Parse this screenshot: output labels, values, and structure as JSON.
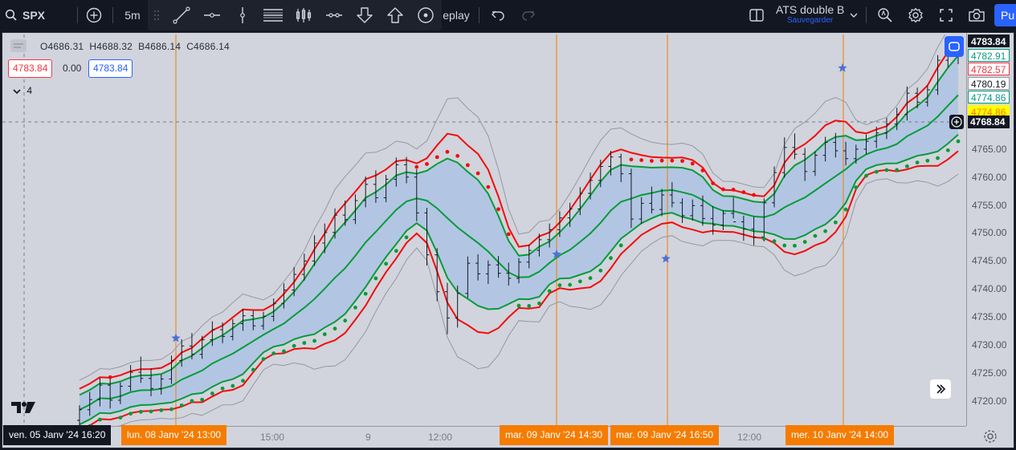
{
  "toolbar": {
    "symbol": "SPX",
    "interval": "5m",
    "replay_label": "eplay",
    "layout_name": "ATS double B",
    "layout_status": "Sauvegarder",
    "publish_label": "Pu"
  },
  "legend": {
    "open": "O4686.31",
    "high": "H4688.32",
    "low": "B4686.14",
    "close": "C4686.14",
    "bid": "4783.84",
    "spread": "0.00",
    "ask": "4783.84",
    "indicators_count": "4"
  },
  "price_axis": {
    "ticks": [
      "4765.00",
      "4760.00",
      "4755.00",
      "4750.00",
      "4745.00",
      "4740.00",
      "4735.00",
      "4730.00",
      "4725.00",
      "4720.00"
    ],
    "labels": [
      {
        "text": "4783.84",
        "bg": "#131722",
        "fg": "#ffffff"
      },
      {
        "text": "4782.91",
        "bg": "#ffffff",
        "fg": "#089981",
        "border": "#089981"
      },
      {
        "text": "4782.57",
        "bg": "#ffffff",
        "fg": "#f23645",
        "border": "#f23645"
      },
      {
        "text": "4780.19",
        "bg": "#ffffff",
        "fg": "#131722",
        "border": "#9598a1"
      },
      {
        "text": "4774.86",
        "bg": "#ffffff",
        "fg": "#089981",
        "border": "#089981"
      },
      {
        "text": "4774.86",
        "bg": "#ffff00",
        "fg": "#f57c00",
        "border": "#ffff00"
      }
    ],
    "crosshair_price": "4768.84"
  },
  "time_axis": {
    "ticks": [
      "15:00",
      "9",
      "12:00",
      "12:00"
    ],
    "markers": [
      {
        "text": "ven. 05 Janv '24   16:20",
        "style": "dark"
      },
      {
        "text": "lun. 08 Janv '24   13:00",
        "style": "orange"
      },
      {
        "text": "mar. 09 Janv '24   14:30",
        "style": "orange"
      },
      {
        "text": "mar. 09 Janv '24   16:50",
        "style": "orange"
      },
      {
        "text": "mer. 10 Janv '24   14:00",
        "style": "orange"
      }
    ]
  },
  "chart_data": {
    "type": "candlestick",
    "symbol": "SPX",
    "interval": "5m",
    "ylim": [
      4715.5,
      4785.5
    ],
    "ohlc": [
      [
        4716.5,
        4719.2,
        4714.8,
        4718.4
      ],
      [
        4718.4,
        4721.6,
        4717.3,
        4720.2
      ],
      [
        4720.2,
        4724.1,
        4719.0,
        4722.8
      ],
      [
        4722.8,
        4724.0,
        4718.6,
        4720.1
      ],
      [
        4720.1,
        4723.3,
        4719.4,
        4722.6
      ],
      [
        4722.6,
        4726.4,
        4721.7,
        4725.1
      ],
      [
        4725.1,
        4727.9,
        4723.2,
        4724.0
      ],
      [
        4724.0,
        4725.8,
        4720.8,
        4722.2
      ],
      [
        4722.2,
        4724.7,
        4721.1,
        4723.9
      ],
      [
        4723.9,
        4728.1,
        4723.0,
        4727.2
      ],
      [
        4727.2,
        4731.0,
        4726.1,
        4729.8
      ],
      [
        4729.8,
        4732.1,
        4727.4,
        4728.3
      ],
      [
        4728.3,
        4731.6,
        4727.5,
        4730.9
      ],
      [
        4730.9,
        4734.2,
        4729.8,
        4732.7
      ],
      [
        4732.7,
        4734.0,
        4730.3,
        4731.5
      ],
      [
        4731.5,
        4734.6,
        4730.8,
        4733.8
      ],
      [
        4733.8,
        4736.4,
        4732.5,
        4735.2
      ],
      [
        4735.2,
        4736.1,
        4732.6,
        4733.4
      ],
      [
        4733.4,
        4735.9,
        4732.7,
        4735.1
      ],
      [
        4735.1,
        4738.3,
        4734.2,
        4737.4
      ],
      [
        4737.4,
        4741.0,
        4736.5,
        4739.8
      ],
      [
        4739.8,
        4743.9,
        4738.7,
        4742.6
      ],
      [
        4742.6,
        4746.3,
        4741.5,
        4745.0
      ],
      [
        4745.0,
        4749.6,
        4744.1,
        4748.2
      ],
      [
        4748.2,
        4751.7,
        4746.4,
        4750.1
      ],
      [
        4750.1,
        4754.4,
        4749.0,
        4753.2
      ],
      [
        4753.2,
        4755.8,
        4751.3,
        4752.4
      ],
      [
        4752.4,
        4756.9,
        4751.6,
        4755.8
      ],
      [
        4755.8,
        4760.1,
        4754.6,
        4758.7
      ],
      [
        4758.7,
        4761.2,
        4755.4,
        4756.3
      ],
      [
        4756.3,
        4760.4,
        4755.5,
        4759.6
      ],
      [
        4759.6,
        4763.5,
        4758.3,
        4762.2
      ],
      [
        4762.2,
        4763.6,
        4758.9,
        4760.0
      ],
      [
        4760.0,
        4761.4,
        4752.1,
        4753.6
      ],
      [
        4753.6,
        4754.5,
        4744.2,
        4746.1
      ],
      [
        4746.1,
        4747.3,
        4737.8,
        4739.5
      ],
      [
        4739.5,
        4741.1,
        4731.9,
        4734.8
      ],
      [
        4734.8,
        4740.6,
        4733.1,
        4739.2
      ],
      [
        4739.2,
        4745.8,
        4738.4,
        4744.6
      ],
      [
        4744.6,
        4746.2,
        4741.5,
        4742.7
      ],
      [
        4742.7,
        4745.1,
        4740.9,
        4744.3
      ],
      [
        4744.3,
        4745.9,
        4742.0,
        4742.8
      ],
      [
        4742.8,
        4744.7,
        4740.6,
        4741.9
      ],
      [
        4741.9,
        4745.5,
        4741.0,
        4744.8
      ],
      [
        4744.8,
        4747.9,
        4743.7,
        4746.9
      ],
      [
        4746.9,
        4749.9,
        4745.8,
        4748.8
      ],
      [
        4748.8,
        4751.7,
        4747.4,
        4750.6
      ],
      [
        4750.6,
        4753.9,
        4749.3,
        4752.7
      ],
      [
        4752.7,
        4755.4,
        4751.1,
        4754.3
      ],
      [
        4754.3,
        4758.2,
        4753.2,
        4757.1
      ],
      [
        4757.1,
        4760.8,
        4756.0,
        4759.4
      ],
      [
        4759.4,
        4763.1,
        4758.2,
        4761.9
      ],
      [
        4761.9,
        4764.7,
        4760.3,
        4763.6
      ],
      [
        4763.6,
        4764.2,
        4759.1,
        4760.6
      ],
      [
        4760.6,
        4761.5,
        4750.9,
        4752.5
      ],
      [
        4752.5,
        4756.4,
        4751.6,
        4755.3
      ],
      [
        4755.3,
        4758.3,
        4753.5,
        4754.2
      ],
      [
        4754.2,
        4757.9,
        4753.0,
        4756.8
      ],
      [
        4756.8,
        4759.1,
        4754.6,
        4755.4
      ],
      [
        4755.4,
        4756.2,
        4751.8,
        4753.1
      ],
      [
        4753.1,
        4756.0,
        4752.2,
        4754.9
      ],
      [
        4754.9,
        4756.7,
        4751.3,
        4752.6
      ],
      [
        4752.6,
        4754.8,
        4749.7,
        4751.4
      ],
      [
        4751.4,
        4754.1,
        4750.5,
        4753.5
      ],
      [
        4753.5,
        4756.4,
        4752.6,
        4752.0
      ],
      [
        4752.0,
        4753.1,
        4748.6,
        4750.7
      ],
      [
        4750.7,
        4752.9,
        4747.8,
        4749.3
      ],
      [
        4749.3,
        4756.2,
        4748.5,
        4755.4
      ],
      [
        4755.4,
        4761.9,
        4754.6,
        4760.8
      ],
      [
        4760.8,
        4767.1,
        4759.9,
        4765.3
      ],
      [
        4765.3,
        4767.8,
        4763.2,
        4764.1
      ],
      [
        4764.1,
        4765.2,
        4759.3,
        4761.0
      ],
      [
        4761.0,
        4764.6,
        4760.2,
        4763.9
      ],
      [
        4763.9,
        4767.2,
        4762.8,
        4766.2
      ],
      [
        4766.2,
        4767.9,
        4763.5,
        4764.7
      ],
      [
        4764.7,
        4766.3,
        4762.1,
        4763.3
      ],
      [
        4763.3,
        4765.8,
        4762.4,
        4765.0
      ],
      [
        4765.0,
        4767.6,
        4764.1,
        4766.4
      ],
      [
        4766.4,
        4769.0,
        4765.2,
        4767.9
      ],
      [
        4767.9,
        4770.6,
        4766.8,
        4769.5
      ],
      [
        4769.5,
        4772.4,
        4768.4,
        4771.2
      ],
      [
        4771.2,
        4776.2,
        4770.1,
        4775.0
      ],
      [
        4775.0,
        4776.0,
        4772.3,
        4773.4
      ],
      [
        4773.4,
        4776.4,
        4772.6,
        4775.6
      ],
      [
        4775.6,
        4781.8,
        4774.7,
        4780.9
      ],
      [
        4780.9,
        4784.4,
        4779.6,
        4782.9
      ],
      [
        4782.9,
        4784.8,
        4780.2,
        4783.84
      ]
    ],
    "indicators": [
      "Bollinger Bands (inner, green)",
      "Bollinger Bands (outer, gray)",
      "Envelope (red)",
      "Parabolic SAR"
    ]
  }
}
